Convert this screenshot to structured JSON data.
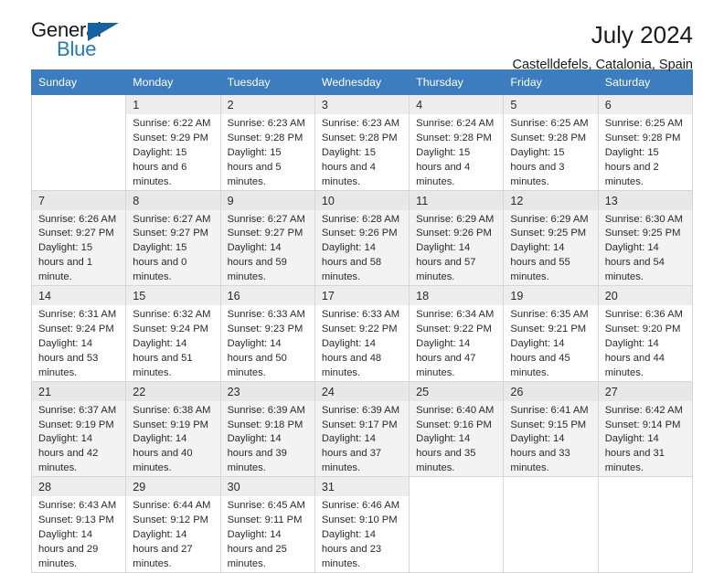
{
  "brand": {
    "name_part1": "General",
    "name_part2": "Blue",
    "triangle_color": "#1464a5",
    "blue": "#1f7ac0"
  },
  "header": {
    "title": "July 2024",
    "subtitle": "Castelldefels, Catalonia, Spain"
  },
  "theme": {
    "header_bg": "#3b7dbf",
    "header_text": "#ffffff",
    "alt_row_bg": "#f3f3f3",
    "daynum_bg": "#ededed",
    "border": "#d6d6d6"
  },
  "weekdays": [
    "Sunday",
    "Monday",
    "Tuesday",
    "Wednesday",
    "Thursday",
    "Friday",
    "Saturday"
  ],
  "labels": {
    "sunrise_prefix": "Sunrise:",
    "sunset_prefix": "Sunset:",
    "daylight_prefix": "Daylight:"
  },
  "weeks": [
    [
      {
        "empty": true
      },
      {
        "day": "1",
        "sunrise": "Sunrise: 6:22 AM",
        "sunset": "Sunset: 9:29 PM",
        "daylight": "Daylight: 15 hours and 6 minutes."
      },
      {
        "day": "2",
        "sunrise": "Sunrise: 6:23 AM",
        "sunset": "Sunset: 9:28 PM",
        "daylight": "Daylight: 15 hours and 5 minutes."
      },
      {
        "day": "3",
        "sunrise": "Sunrise: 6:23 AM",
        "sunset": "Sunset: 9:28 PM",
        "daylight": "Daylight: 15 hours and 4 minutes."
      },
      {
        "day": "4",
        "sunrise": "Sunrise: 6:24 AM",
        "sunset": "Sunset: 9:28 PM",
        "daylight": "Daylight: 15 hours and 4 minutes."
      },
      {
        "day": "5",
        "sunrise": "Sunrise: 6:25 AM",
        "sunset": "Sunset: 9:28 PM",
        "daylight": "Daylight: 15 hours and 3 minutes."
      },
      {
        "day": "6",
        "sunrise": "Sunrise: 6:25 AM",
        "sunset": "Sunset: 9:28 PM",
        "daylight": "Daylight: 15 hours and 2 minutes."
      }
    ],
    [
      {
        "day": "7",
        "sunrise": "Sunrise: 6:26 AM",
        "sunset": "Sunset: 9:27 PM",
        "daylight": "Daylight: 15 hours and 1 minute."
      },
      {
        "day": "8",
        "sunrise": "Sunrise: 6:27 AM",
        "sunset": "Sunset: 9:27 PM",
        "daylight": "Daylight: 15 hours and 0 minutes."
      },
      {
        "day": "9",
        "sunrise": "Sunrise: 6:27 AM",
        "sunset": "Sunset: 9:27 PM",
        "daylight": "Daylight: 14 hours and 59 minutes."
      },
      {
        "day": "10",
        "sunrise": "Sunrise: 6:28 AM",
        "sunset": "Sunset: 9:26 PM",
        "daylight": "Daylight: 14 hours and 58 minutes."
      },
      {
        "day": "11",
        "sunrise": "Sunrise: 6:29 AM",
        "sunset": "Sunset: 9:26 PM",
        "daylight": "Daylight: 14 hours and 57 minutes."
      },
      {
        "day": "12",
        "sunrise": "Sunrise: 6:29 AM",
        "sunset": "Sunset: 9:25 PM",
        "daylight": "Daylight: 14 hours and 55 minutes."
      },
      {
        "day": "13",
        "sunrise": "Sunrise: 6:30 AM",
        "sunset": "Sunset: 9:25 PM",
        "daylight": "Daylight: 14 hours and 54 minutes."
      }
    ],
    [
      {
        "day": "14",
        "sunrise": "Sunrise: 6:31 AM",
        "sunset": "Sunset: 9:24 PM",
        "daylight": "Daylight: 14 hours and 53 minutes."
      },
      {
        "day": "15",
        "sunrise": "Sunrise: 6:32 AM",
        "sunset": "Sunset: 9:24 PM",
        "daylight": "Daylight: 14 hours and 51 minutes."
      },
      {
        "day": "16",
        "sunrise": "Sunrise: 6:33 AM",
        "sunset": "Sunset: 9:23 PM",
        "daylight": "Daylight: 14 hours and 50 minutes."
      },
      {
        "day": "17",
        "sunrise": "Sunrise: 6:33 AM",
        "sunset": "Sunset: 9:22 PM",
        "daylight": "Daylight: 14 hours and 48 minutes."
      },
      {
        "day": "18",
        "sunrise": "Sunrise: 6:34 AM",
        "sunset": "Sunset: 9:22 PM",
        "daylight": "Daylight: 14 hours and 47 minutes."
      },
      {
        "day": "19",
        "sunrise": "Sunrise: 6:35 AM",
        "sunset": "Sunset: 9:21 PM",
        "daylight": "Daylight: 14 hours and 45 minutes."
      },
      {
        "day": "20",
        "sunrise": "Sunrise: 6:36 AM",
        "sunset": "Sunset: 9:20 PM",
        "daylight": "Daylight: 14 hours and 44 minutes."
      }
    ],
    [
      {
        "day": "21",
        "sunrise": "Sunrise: 6:37 AM",
        "sunset": "Sunset: 9:19 PM",
        "daylight": "Daylight: 14 hours and 42 minutes."
      },
      {
        "day": "22",
        "sunrise": "Sunrise: 6:38 AM",
        "sunset": "Sunset: 9:19 PM",
        "daylight": "Daylight: 14 hours and 40 minutes."
      },
      {
        "day": "23",
        "sunrise": "Sunrise: 6:39 AM",
        "sunset": "Sunset: 9:18 PM",
        "daylight": "Daylight: 14 hours and 39 minutes."
      },
      {
        "day": "24",
        "sunrise": "Sunrise: 6:39 AM",
        "sunset": "Sunset: 9:17 PM",
        "daylight": "Daylight: 14 hours and 37 minutes."
      },
      {
        "day": "25",
        "sunrise": "Sunrise: 6:40 AM",
        "sunset": "Sunset: 9:16 PM",
        "daylight": "Daylight: 14 hours and 35 minutes."
      },
      {
        "day": "26",
        "sunrise": "Sunrise: 6:41 AM",
        "sunset": "Sunset: 9:15 PM",
        "daylight": "Daylight: 14 hours and 33 minutes."
      },
      {
        "day": "27",
        "sunrise": "Sunrise: 6:42 AM",
        "sunset": "Sunset: 9:14 PM",
        "daylight": "Daylight: 14 hours and 31 minutes."
      }
    ],
    [
      {
        "day": "28",
        "sunrise": "Sunrise: 6:43 AM",
        "sunset": "Sunset: 9:13 PM",
        "daylight": "Daylight: 14 hours and 29 minutes."
      },
      {
        "day": "29",
        "sunrise": "Sunrise: 6:44 AM",
        "sunset": "Sunset: 9:12 PM",
        "daylight": "Daylight: 14 hours and 27 minutes."
      },
      {
        "day": "30",
        "sunrise": "Sunrise: 6:45 AM",
        "sunset": "Sunset: 9:11 PM",
        "daylight": "Daylight: 14 hours and 25 minutes."
      },
      {
        "day": "31",
        "sunrise": "Sunrise: 6:46 AM",
        "sunset": "Sunset: 9:10 PM",
        "daylight": "Daylight: 14 hours and 23 minutes."
      },
      {
        "empty": true
      },
      {
        "empty": true
      },
      {
        "empty": true
      }
    ]
  ]
}
